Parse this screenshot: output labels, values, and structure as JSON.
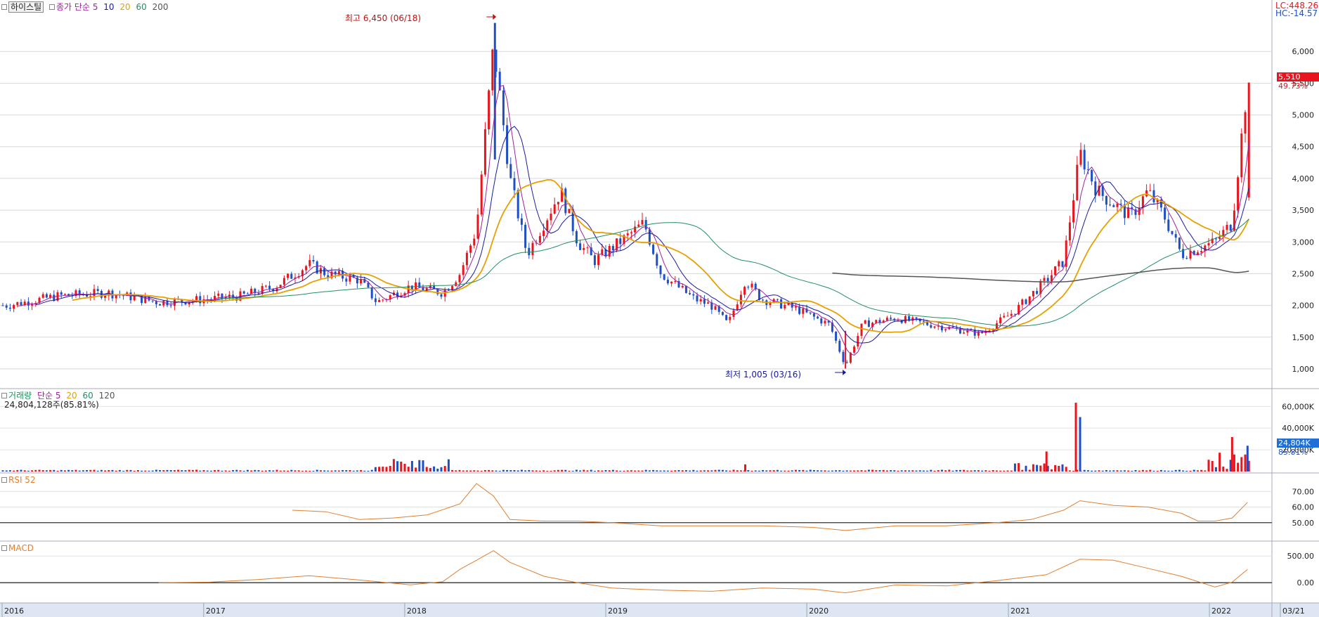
{
  "stock": {
    "name": "하이스틸",
    "price_ma_label": "종가 단순",
    "price_ma_periods": [
      "5",
      "10",
      "20",
      "60",
      "200"
    ],
    "volume_label": "거래량",
    "volume_ma_label": "단순",
    "volume_ma_periods": [
      "5",
      "20",
      "60",
      "120"
    ],
    "volume_info": "24,804,128주(85.81%)",
    "lc": "LC:448.26",
    "hc": "HC:-14.57",
    "current_price": "5,510",
    "current_change": "49.73%",
    "current_volume": "24,804K",
    "current_volume_pct": "85.81%",
    "high_annotation": "최고 6,450 (06/18)",
    "low_annotation": "최저 1,005 (03/16)",
    "rsi_label": "RSI 52",
    "macd_label": "MACD",
    "last_date": "03/21"
  },
  "colors": {
    "up": "#e8141e",
    "down": "#1f4fc4",
    "ma5": "#a020a0",
    "ma10": "#1a1aa0",
    "ma20": "#e8a000",
    "ma60": "#209060",
    "ma200": "#555555",
    "rsi": "#e08030",
    "macd": "#e08030"
  },
  "chart_data": [
    {
      "type": "candlestick",
      "title": "하이스틸",
      "x": [
        "2016",
        "2017",
        "2018",
        "2019",
        "2020",
        "2021",
        "2022",
        "03/21"
      ],
      "ylim": [
        800,
        6700
      ],
      "yticks": [
        "1,000",
        "1,500",
        "2,000",
        "2,500",
        "3,000",
        "3,500",
        "4,000",
        "4,500",
        "5,000",
        "5,500",
        "6,000"
      ],
      "close_series": [
        [
          "2016-01",
          2000
        ],
        [
          "2016-04",
          2150
        ],
        [
          "2016-07",
          2200
        ],
        [
          "2016-10",
          2050
        ],
        [
          "2017-01",
          2100
        ],
        [
          "2017-03",
          2150
        ],
        [
          "2017-05",
          2300
        ],
        [
          "2017-07",
          2650
        ],
        [
          "2017-08",
          2500
        ],
        [
          "2017-10",
          2400
        ],
        [
          "2017-11",
          2050
        ],
        [
          "2018-01",
          2300
        ],
        [
          "2018-03",
          2200
        ],
        [
          "2018-04",
          2500
        ],
        [
          "2018-05",
          3200
        ],
        [
          "2018-06",
          6100
        ],
        [
          "2018-07",
          4000
        ],
        [
          "2018-08",
          2800
        ],
        [
          "2018-10",
          3800
        ],
        [
          "2018-11",
          3000
        ],
        [
          "2018-12",
          2700
        ],
        [
          "2019-01",
          2900
        ],
        [
          "2019-02",
          3100
        ],
        [
          "2019-03",
          3300
        ],
        [
          "2019-04",
          2500
        ],
        [
          "2019-05",
          2300
        ],
        [
          "2019-06",
          2100
        ],
        [
          "2019-07",
          2000
        ],
        [
          "2019-08",
          1700
        ],
        [
          "2019-09",
          2400
        ],
        [
          "2019-10",
          2100
        ],
        [
          "2019-12",
          1950
        ],
        [
          "2020-02",
          1700
        ],
        [
          "2020-03",
          1050
        ],
        [
          "2020-04",
          1700
        ],
        [
          "2020-06",
          1800
        ],
        [
          "2020-08",
          1700
        ],
        [
          "2020-09",
          1650
        ],
        [
          "2020-11",
          1550
        ],
        [
          "2021-01",
          1900
        ],
        [
          "2021-03",
          2400
        ],
        [
          "2021-04",
          2700
        ],
        [
          "2021-05",
          4400
        ],
        [
          "2021-06",
          3800
        ],
        [
          "2021-07",
          3600
        ],
        [
          "2021-08",
          3400
        ],
        [
          "2021-09",
          3800
        ],
        [
          "2021-10",
          3400
        ],
        [
          "2021-11",
          2800
        ],
        [
          "2021-12",
          2900
        ],
        [
          "2022-01",
          3000
        ],
        [
          "2022-02",
          3300
        ],
        [
          "2022-03",
          5510
        ]
      ],
      "high": {
        "value": 6450,
        "date": "06/18"
      },
      "low": {
        "value": 1005,
        "date": "03/16"
      },
      "last_close": 5510
    },
    {
      "type": "bar",
      "title": "거래량",
      "yticks": [
        "20,000K",
        "40,000K",
        "60,000K"
      ],
      "last_value": 24804128
    },
    {
      "type": "line",
      "title": "RSI 52",
      "yticks": [
        "50.00",
        "60.00",
        "70.00"
      ],
      "ylim": [
        40,
        80
      ],
      "series": [
        [
          "2017-06",
          58
        ],
        [
          "2017-08",
          57
        ],
        [
          "2017-10",
          52
        ],
        [
          "2017-12",
          53
        ],
        [
          "2018-02",
          55
        ],
        [
          "2018-04",
          62
        ],
        [
          "2018-05",
          75
        ],
        [
          "2018-06",
          67
        ],
        [
          "2018-07",
          52
        ],
        [
          "2018-09",
          51
        ],
        [
          "2018-11",
          51
        ],
        [
          "2019-01",
          50
        ],
        [
          "2019-04",
          48
        ],
        [
          "2019-07",
          48
        ],
        [
          "2019-10",
          48
        ],
        [
          "2020-01",
          47
        ],
        [
          "2020-03",
          45
        ],
        [
          "2020-06",
          48
        ],
        [
          "2020-09",
          48
        ],
        [
          "2020-12",
          50
        ],
        [
          "2021-02",
          52
        ],
        [
          "2021-04",
          58
        ],
        [
          "2021-05",
          64
        ],
        [
          "2021-07",
          61
        ],
        [
          "2021-09",
          60
        ],
        [
          "2021-11",
          56
        ],
        [
          "2021-12",
          51
        ],
        [
          "2022-01",
          51
        ],
        [
          "2022-02",
          53
        ],
        [
          "2022-03",
          63
        ]
      ]
    },
    {
      "type": "line",
      "title": "MACD",
      "yticks": [
        "0.00",
        "500.00"
      ],
      "ylim": [
        -300,
        700
      ],
      "series": [
        [
          "2016-10",
          0
        ],
        [
          "2017-01",
          10
        ],
        [
          "2017-04",
          60
        ],
        [
          "2017-07",
          130
        ],
        [
          "2017-10",
          50
        ],
        [
          "2018-01",
          -40
        ],
        [
          "2018-03",
          20
        ],
        [
          "2018-04",
          250
        ],
        [
          "2018-05",
          420
        ],
        [
          "2018-06",
          600
        ],
        [
          "2018-07",
          380
        ],
        [
          "2018-09",
          120
        ],
        [
          "2018-11",
          0
        ],
        [
          "2019-01",
          -100
        ],
        [
          "2019-04",
          -140
        ],
        [
          "2019-07",
          -160
        ],
        [
          "2019-10",
          -100
        ],
        [
          "2020-01",
          -120
        ],
        [
          "2020-03",
          -190
        ],
        [
          "2020-06",
          -40
        ],
        [
          "2020-09",
          -60
        ],
        [
          "2020-12",
          40
        ],
        [
          "2021-03",
          150
        ],
        [
          "2021-05",
          440
        ],
        [
          "2021-07",
          420
        ],
        [
          "2021-09",
          270
        ],
        [
          "2021-11",
          120
        ],
        [
          "2022-01",
          -80
        ],
        [
          "2022-02",
          10
        ],
        [
          "2022-03",
          250
        ]
      ]
    }
  ]
}
